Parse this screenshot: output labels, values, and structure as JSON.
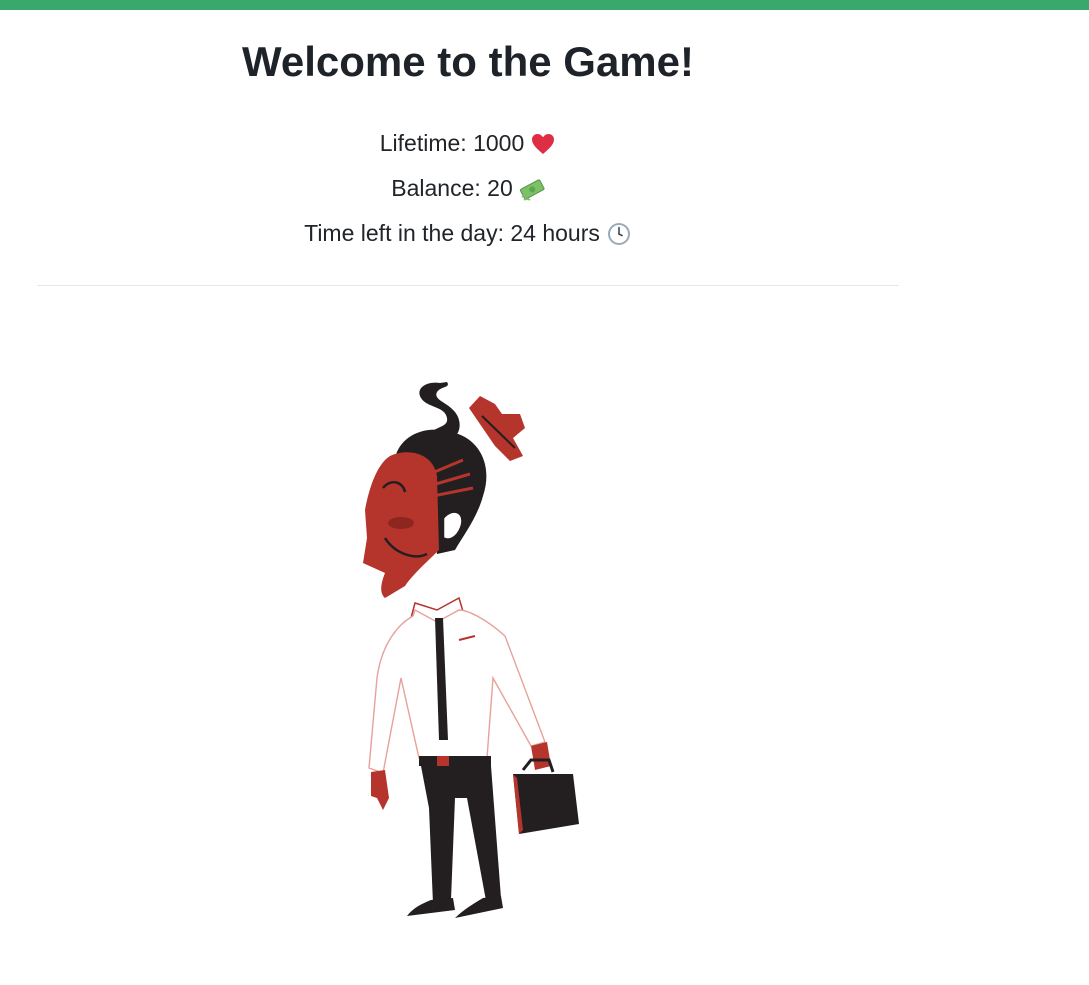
{
  "header": {
    "accent_color": "#3aa76d"
  },
  "game": {
    "title": "Welcome to the Game!",
    "lifetime_label": "Lifetime: 1000",
    "lifetime_icon": "heart-icon",
    "balance_label": "Balance: 20",
    "balance_icon": "money-icon",
    "time_label": "Time left in the day: 24 hours",
    "time_icon": "clock-icon"
  },
  "character": {
    "name": "businessman-character",
    "primary_color": "#b5342c",
    "dark_color": "#231f20"
  }
}
